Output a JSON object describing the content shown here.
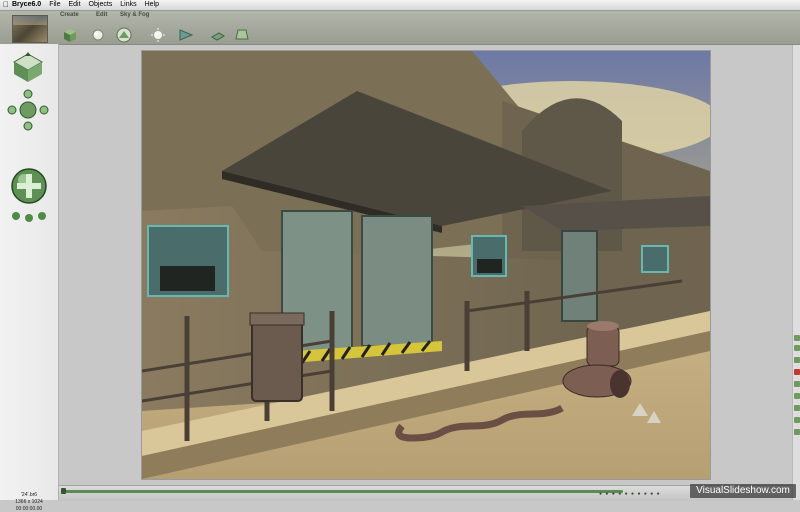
{
  "menubar": {
    "app_name": "Bryce6.0",
    "items": [
      "File",
      "Edit",
      "Objects",
      "Links",
      "Help"
    ]
  },
  "toolbar": {
    "tabs": {
      "create": "Create",
      "edit": "Edit",
      "sky": "Sky & Fog"
    },
    "tools": [
      {
        "icon": "cube-object-icon"
      },
      {
        "icon": "light-sphere-icon"
      },
      {
        "icon": "terrain-icon"
      },
      {
        "icon": "light-icon"
      },
      {
        "icon": "camera-icon"
      },
      {
        "icon": "plane-icon"
      },
      {
        "icon": "material-icon"
      }
    ]
  },
  "file_info": {
    "name": "'24'.br6",
    "dimensions": "1366 x 1024",
    "timecode": "00:00:00.00"
  },
  "watermark": "VisualSlideshow.com",
  "colors": {
    "toolbar": "#a7aa9e",
    "panel": "#eeeeee",
    "accent_green": "#4f8a47",
    "workspace": "#c8c8c8"
  }
}
